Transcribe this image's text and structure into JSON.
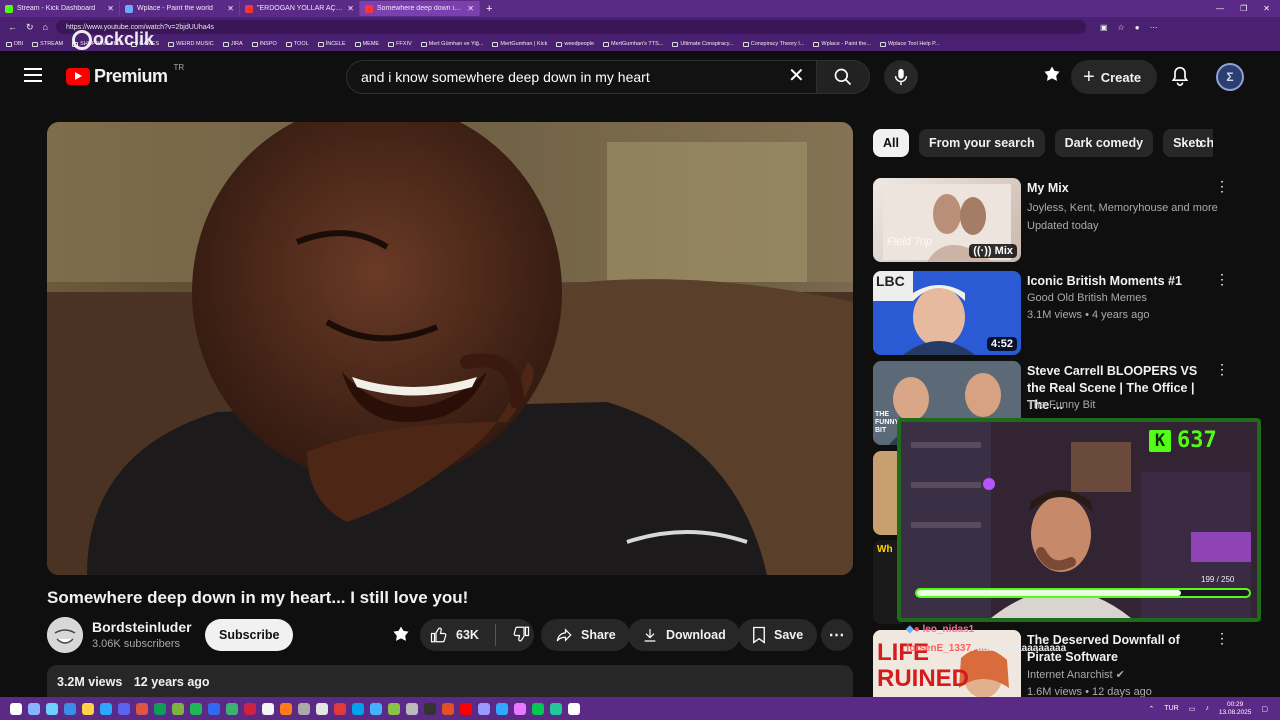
{
  "browser": {
    "tabs": [
      {
        "title": "Stream - Kick Dashboard",
        "color": "#53fc18"
      },
      {
        "title": "Wplace - Paint the world",
        "color": "#6fa8ff"
      },
      {
        "title": "\"ERDOĞAN YOLLAR AÇTI, GİDİP...",
        "color": "#ff3333"
      },
      {
        "title": "Somewhere deep down in m...",
        "color": "#ff3333"
      }
    ],
    "url": "https://www.youtube.com/watch?v=2bjdUUha4s",
    "bookmarks": [
      "DBI",
      "STREAM",
      "SHOPPING LIST",
      "GAMES",
      "WEIRD MUSIC",
      "JIRA",
      "INSPO",
      "TOOL",
      "İNCELE",
      "MEME",
      "FFXIV",
      "Mert Gümhan ve Yiğ...",
      "MertGumhan | Kick",
      "weedpeople",
      "MertGumhan's TTS...",
      "Ultimate Conspiracy...",
      "Conspiracy Theory I...",
      "Wplace - Paint the...",
      "Wplace Tool Help P..."
    ],
    "watermark": "ockclik"
  },
  "header": {
    "logo_text": "Premium",
    "country": "TR",
    "search_query": "and i know somewhere deep down in my heart",
    "create_label": "Create",
    "avatar_letter": "Σ"
  },
  "video": {
    "title": "Somewhere deep down in my heart... I still love you!",
    "channel": "Bordsteinluder",
    "subscribers": "3.06K subscribers",
    "subscribe_label": "Subscribe",
    "likes": "63K",
    "share_label": "Share",
    "download_label": "Download",
    "save_label": "Save",
    "views": "3.2M views",
    "age": "12 years ago"
  },
  "chips": [
    "All",
    "From your search",
    "Dark comedy",
    "Sketch"
  ],
  "related": [
    {
      "title": "My Mix",
      "line1": "Joyless, Kent, Memoryhouse and more",
      "line2": "Updated today",
      "badge": "Mix",
      "thumb_text": "Field Trip"
    },
    {
      "title": "Iconic British Moments #1",
      "line1": "Good Old British Memes",
      "line2": "3.1M views • 4 years ago",
      "badge": "4:52",
      "thumb_text": "LBC"
    },
    {
      "title": "Steve Carrell BLOOPERS VS the Real Scene | The Office | The ...",
      "line1": "The Funny Bit",
      "line2": "",
      "badge": "",
      "thumb_text": "THE FUNNY BIT"
    },
    {
      "title": "The Deserved Downfall of Pirate Software",
      "line1": "Internet Anarchist",
      "line2": "1.6M views • 12 days ago",
      "badge": "",
      "thumb_text": "LIFE RUINED"
    }
  ],
  "stream_overlay": {
    "kick_count": "637",
    "goal_current": 199,
    "goal_total": 250,
    "goal_text": "199 / 250",
    "chat": [
      {
        "user": "leo_nidas1",
        "msg": ""
      },
      {
        "user": "forsenE_1337",
        "msg": ": aaaaaaaaaaaaaaaa"
      }
    ]
  },
  "taskbar": {
    "lang": "TUR",
    "time": "00:29",
    "date": "13.08.2025"
  }
}
